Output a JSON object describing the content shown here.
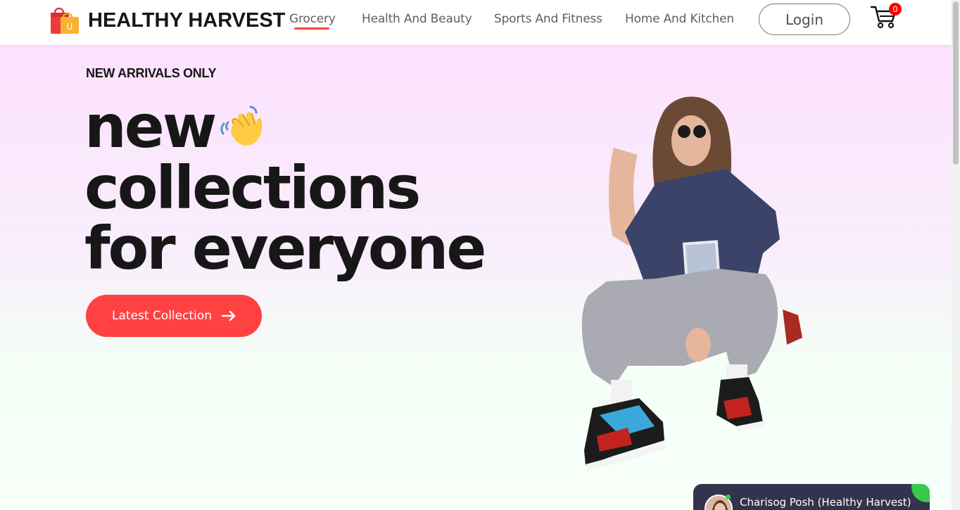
{
  "navbar": {
    "brand_name": "HEALTHY HARVEST",
    "logo_icon": "shopping-bag-icon",
    "nav_items": [
      {
        "label": "Grocery",
        "active": true
      },
      {
        "label": "Health And Beauty",
        "active": false
      },
      {
        "label": "Sports And Fitness",
        "active": false
      },
      {
        "label": "Home And Kitchen",
        "active": false
      }
    ],
    "login_label": "Login",
    "cart_icon": "cart-icon",
    "cart_count": "0"
  },
  "hero": {
    "eyebrow": "NEW ARRIVALS ONLY",
    "headline_line1": "new",
    "headline_line2": "collections",
    "headline_line3": "for everyone",
    "wave_icon": "waving-hand-icon",
    "cta_label": "Latest Collection",
    "cta_icon": "arrow-right-icon",
    "image": "hero-model-image"
  },
  "chat_widget": {
    "name": "Charisog Posh (Healthy Harvest)",
    "status": "online"
  },
  "colors": {
    "accent": "#ff4141",
    "text": "#171717",
    "hero_top": "#fde1ff",
    "hero_bottom": "#f8fffa",
    "chat_bg": "#33334d",
    "online": "#3bc94d"
  }
}
